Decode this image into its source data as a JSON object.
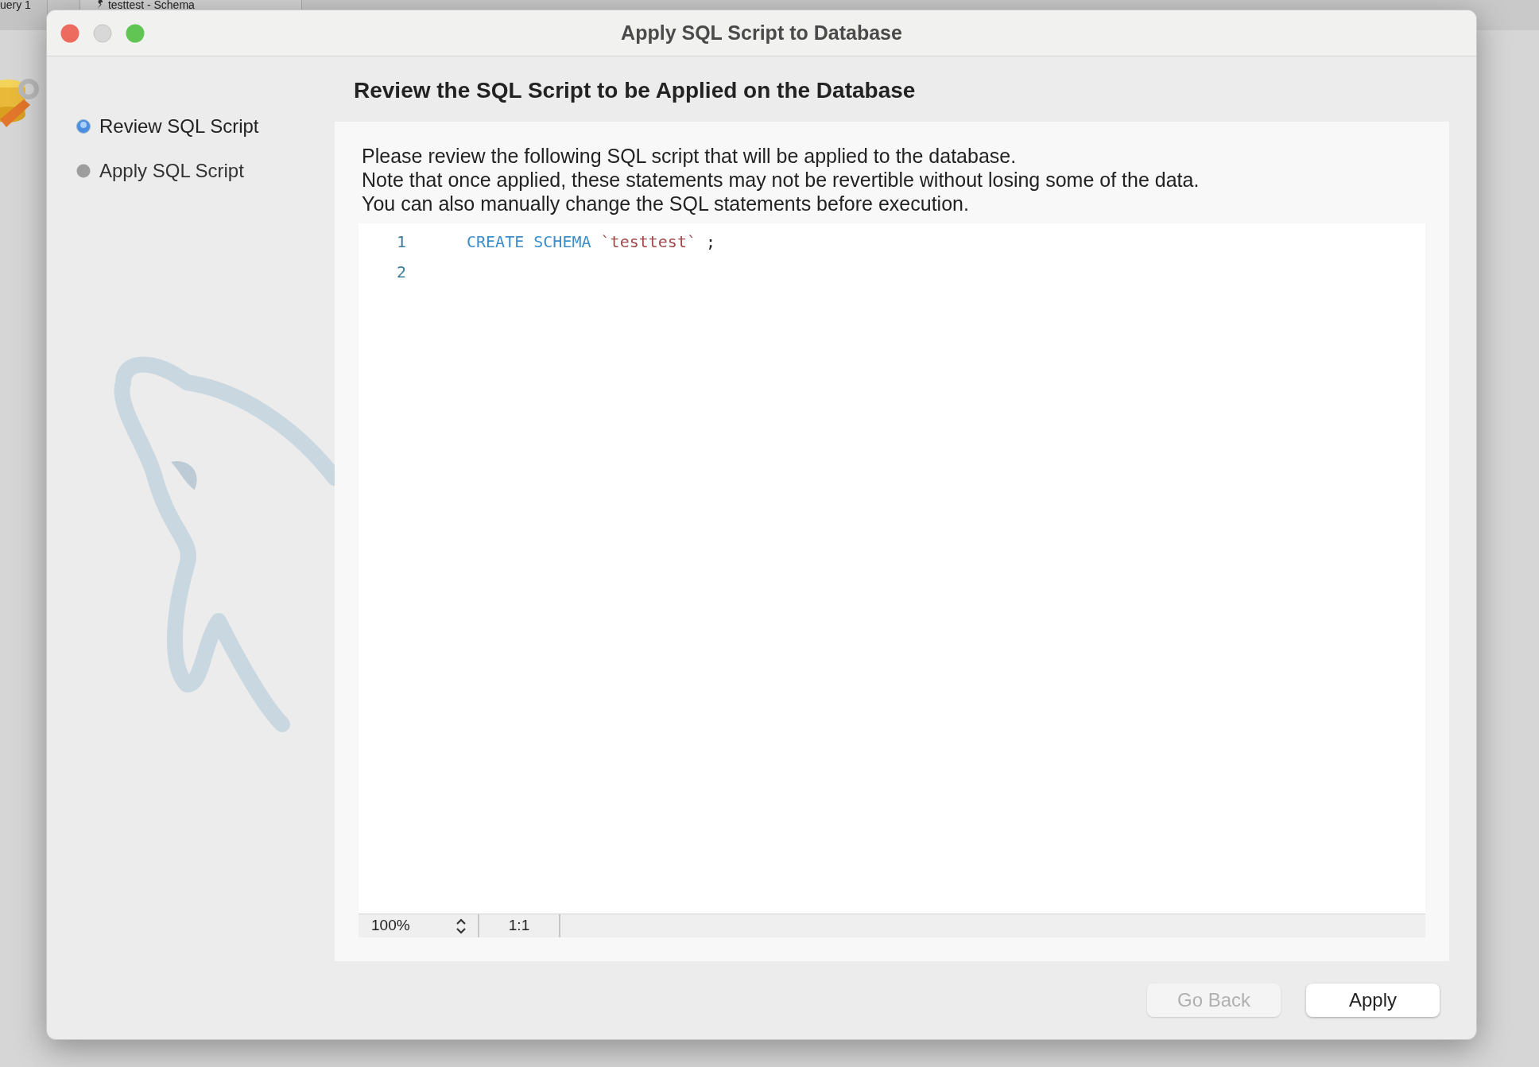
{
  "background_tabs": [
    {
      "label": "uery 1",
      "kind": "query"
    },
    {
      "label": "testtest - Schema",
      "kind": "schema"
    }
  ],
  "window": {
    "title": "Apply SQL Script to Database"
  },
  "steps": [
    {
      "label": "Review SQL Script",
      "selected": true
    },
    {
      "label": "Apply SQL Script",
      "selected": false
    }
  ],
  "heading": "Review the SQL Script to be Applied on the Database",
  "description": [
    "Please review the following SQL script that will be applied to the database.",
    "Note that once applied, these statements may not be revertible without losing some of the data.",
    "You can also manually change the SQL statements before execution."
  ],
  "editor": {
    "lines": [
      {
        "number": "1",
        "tokens": [
          {
            "kind": "keyword",
            "text": "CREATE SCHEMA"
          },
          {
            "kind": "string",
            "text": "`testtest`"
          },
          {
            "kind": "plain",
            "text": ";"
          }
        ]
      },
      {
        "number": "2"
      }
    ],
    "zoom": "100%",
    "position": "1:1"
  },
  "buttons": [
    {
      "label": "Go Back",
      "disabled": true
    },
    {
      "label": "Apply",
      "disabled": false
    }
  ]
}
